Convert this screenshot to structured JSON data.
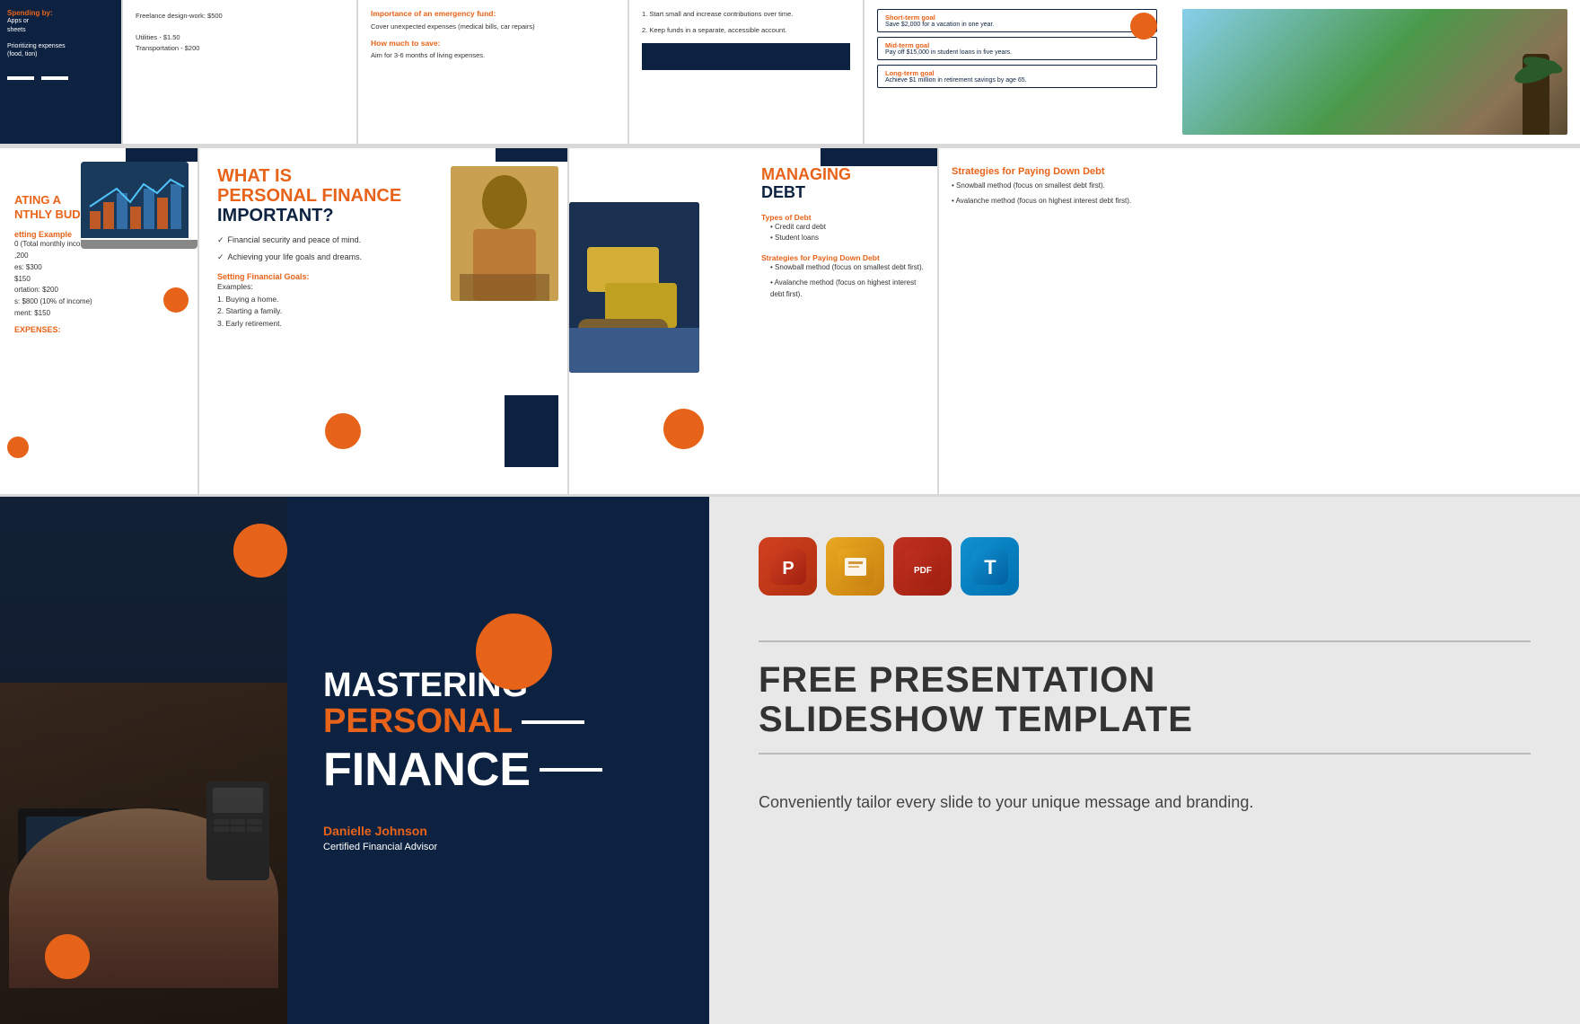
{
  "colors": {
    "navy": "#0d2240",
    "orange": "#e8631a",
    "white": "#ffffff",
    "lightgray": "#e8e8e8",
    "darktext": "#333333"
  },
  "topRow": {
    "slide1": {
      "label": "Spending by:",
      "items": [
        "Apps or",
        "sheets",
        ""
      ],
      "note": "Prioritizing expenses",
      "subNote": "(food, tion)"
    },
    "slide2": {
      "freelance": "Freelance design-work: $500",
      "utilities": "Utilities - $1.50",
      "transportation": "Transportation - $200"
    },
    "slide3": {
      "heading": "Importance of an emergency fund:",
      "body": "Cover unexpected expenses (medical bills, car repairs)",
      "subheading": "How much to save:",
      "subbody": "Aim for 3-6 months of living expenses."
    },
    "slide4": {
      "items": [
        "Start small and increase contributions over time.",
        "Keep funds in a separate, accessible account."
      ]
    },
    "slide5": {
      "shortTermLabel": "Short-term goal",
      "shortTermText": "Save $2,000 for a vacation in one year.",
      "midTermLabel": "Mid-term goal",
      "midTermText": "Pay off $15,000 in student loans in five years.",
      "longTermLabel": "Long-term goal",
      "longTermText": "Achieve $1 million in retirement savings by age 65."
    }
  },
  "midRow": {
    "slide1": {
      "title1": "ATING A",
      "title2": "NTHLY BUDGET",
      "exampleLabel": "etting Example",
      "exampleItems": [
        "0 (Total monthly income)",
        "",
        ",200",
        "es: $300",
        "$150",
        "ortation: $200",
        "s: $800 (10% of income)",
        "ment: $150"
      ],
      "expensesLabel": "EXPENSES:"
    },
    "slide2": {
      "titleLine1": "WHAT IS",
      "titleLine2": "PERSONAL FINANCE",
      "titleLine3": "IMPORTANT?",
      "check1": "Financial security and peace of mind.",
      "check2": "Achieving your life goals and dreams.",
      "settingLabel": "Setting Financial Goals:",
      "examples": "Examples:",
      "item1": "Buying a home.",
      "item2": "Starting a family.",
      "item3": "Early retirement."
    },
    "slide3": {
      "titleLine1": "MANAGING",
      "titleLine2": "DEBT",
      "typesLabel": "Types of Debt",
      "type1": "Credit card debt",
      "type2": "Student loans",
      "strategiesLabel": "Strategies for Paying Down Debt",
      "strategy1": "Snowball method (focus on smallest debt first).",
      "strategy2": "Avalanche method (focus on highest interest debt first)."
    }
  },
  "mainSlide": {
    "line1": "MASTERING",
    "line2": "PERSONAL",
    "line3": "FINANCE",
    "authorName": "Danielle Johnson",
    "authorTitle": "Certified Financial Advisor"
  },
  "rightPanel": {
    "icons": [
      {
        "type": "ppt",
        "label": "P"
      },
      {
        "type": "slides",
        "label": "G"
      },
      {
        "type": "pdf",
        "label": "PDF"
      },
      {
        "type": "text",
        "label": "T"
      }
    ],
    "titleLine1": "FREE PRESENTATION",
    "titleLine2": "SLIDESHOW TEMPLATE",
    "tagline": "Conveniently tailor every slide to your unique message and branding."
  }
}
